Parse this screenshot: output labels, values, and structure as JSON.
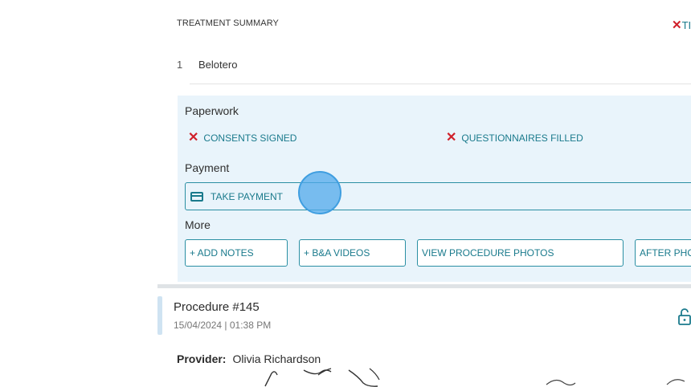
{
  "summary": {
    "title": "TREATMENT SUMMARY",
    "top_right_x": "✕",
    "top_right_text": "TI"
  },
  "treatments": [
    {
      "num": "1",
      "name": "Belotero"
    }
  ],
  "paperwork": {
    "label": "Paperwork",
    "consents": "CONSENTS SIGNED",
    "questionnaires": "QUESTIONNAIRES FILLED",
    "x_glyph": "✕"
  },
  "payment": {
    "label": "Payment",
    "take_payment": "TAKE PAYMENT"
  },
  "more": {
    "label": "More",
    "add_notes": "+ ADD NOTES",
    "ba_videos": "+ B&A VIDEOS",
    "procedure_photos": "VIEW PROCEDURE PHOTOS",
    "after_photos": "AFTER PHO"
  },
  "procedure": {
    "title": "Procedure #145",
    "datetime": "15/04/2024 | 01:38 PM",
    "provider_label": "Provider:",
    "provider_name": "Olivia Richardson"
  },
  "colors": {
    "accent": "#1a7a8c",
    "error": "#d0202a",
    "panel_bg": "#e9f4fb"
  }
}
